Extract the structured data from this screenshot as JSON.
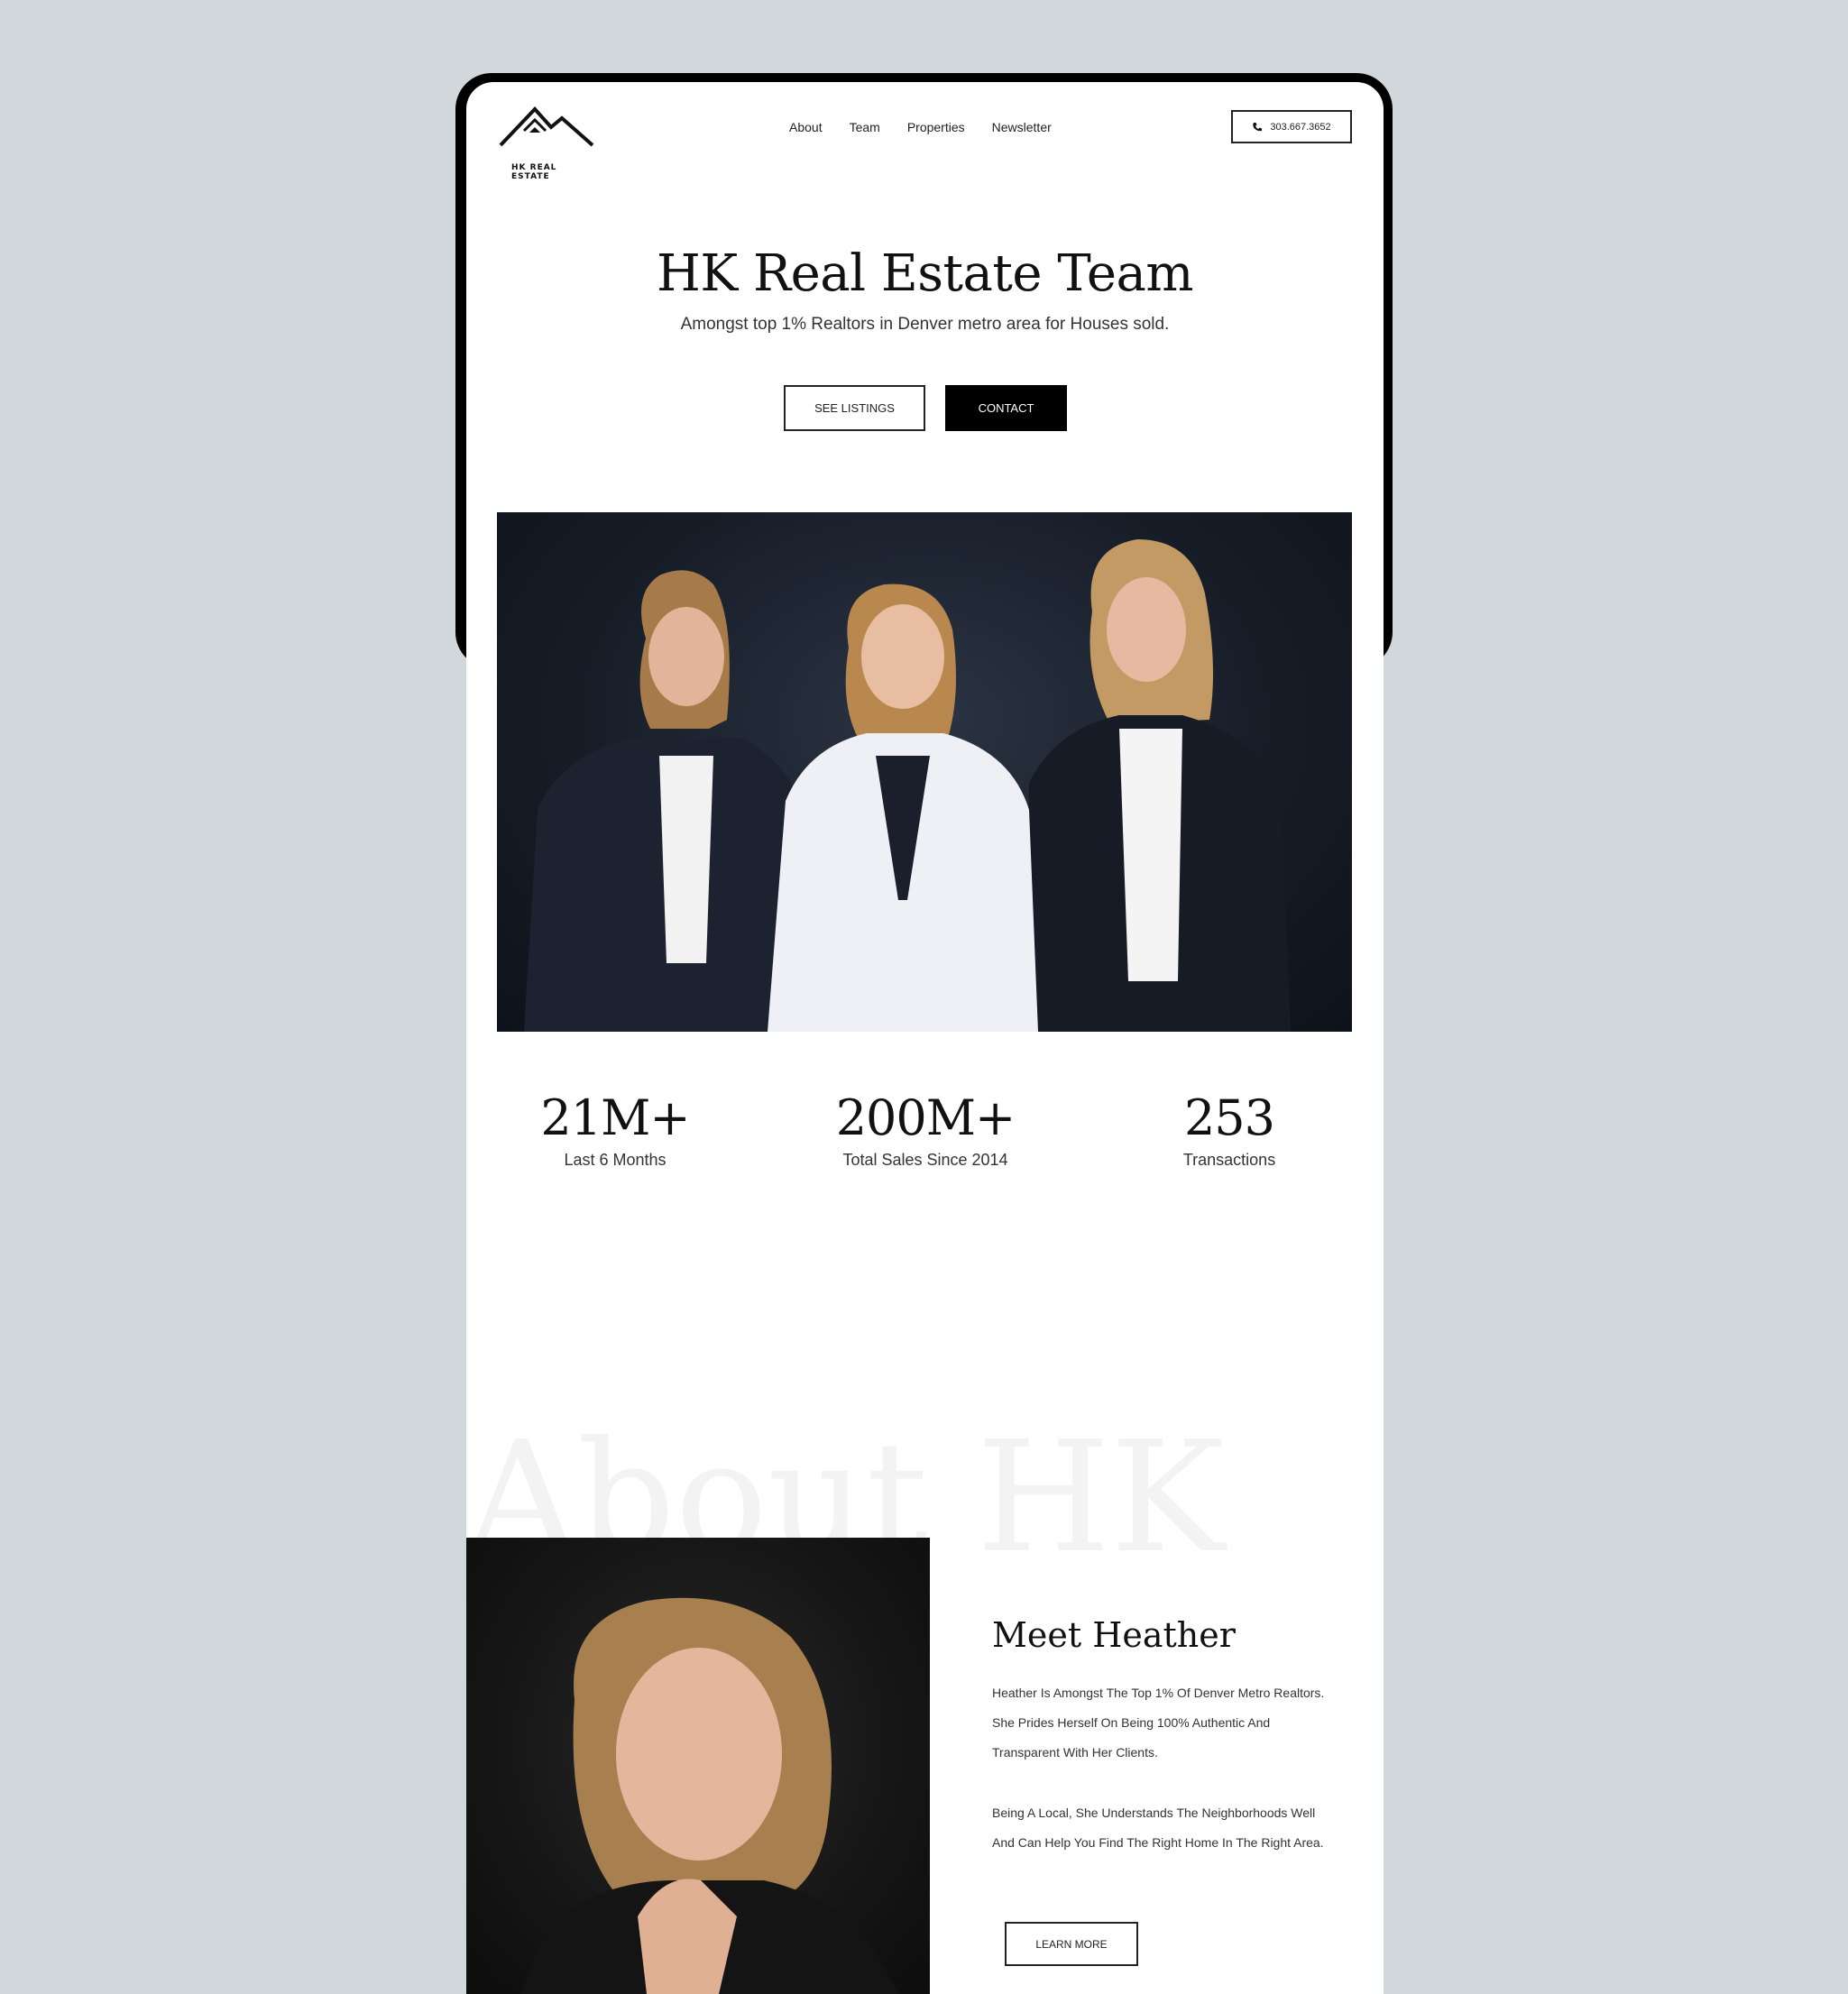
{
  "nav": {
    "logo_text": "HK REAL ESTATE",
    "links": [
      "About",
      "Team",
      "Properties",
      "Newsletter"
    ],
    "phone": "303.667.3652"
  },
  "hero": {
    "title": "HK Real Estate Team",
    "subtitle": "Amongst top 1% Realtors in Denver metro area for Houses sold.",
    "see_listings": "SEE LISTINGS",
    "contact": "CONTACT"
  },
  "stats": [
    {
      "value": "21M+",
      "label": "Last 6 Months"
    },
    {
      "value": "200M+",
      "label": "Total Sales Since 2014"
    },
    {
      "value": "253",
      "label": "Transactions"
    }
  ],
  "about": {
    "background_word": "About HK",
    "title": "Meet Heather",
    "paragraph_1": "Heather Is Amongst The Top 1% Of Denver Metro Realtors. She Prides Herself On Being 100% Authentic And Transparent With Her Clients.",
    "paragraph_2": "Being A Local, She Understands The Neighborhoods Well And Can Help You Find The Right Home In The Right Area.",
    "learn_more": "LEARN MORE"
  },
  "colors": {
    "backdrop": "#d2d7db",
    "page": "#ffffff",
    "ink": "#111111",
    "accent_dark": "#000000"
  }
}
